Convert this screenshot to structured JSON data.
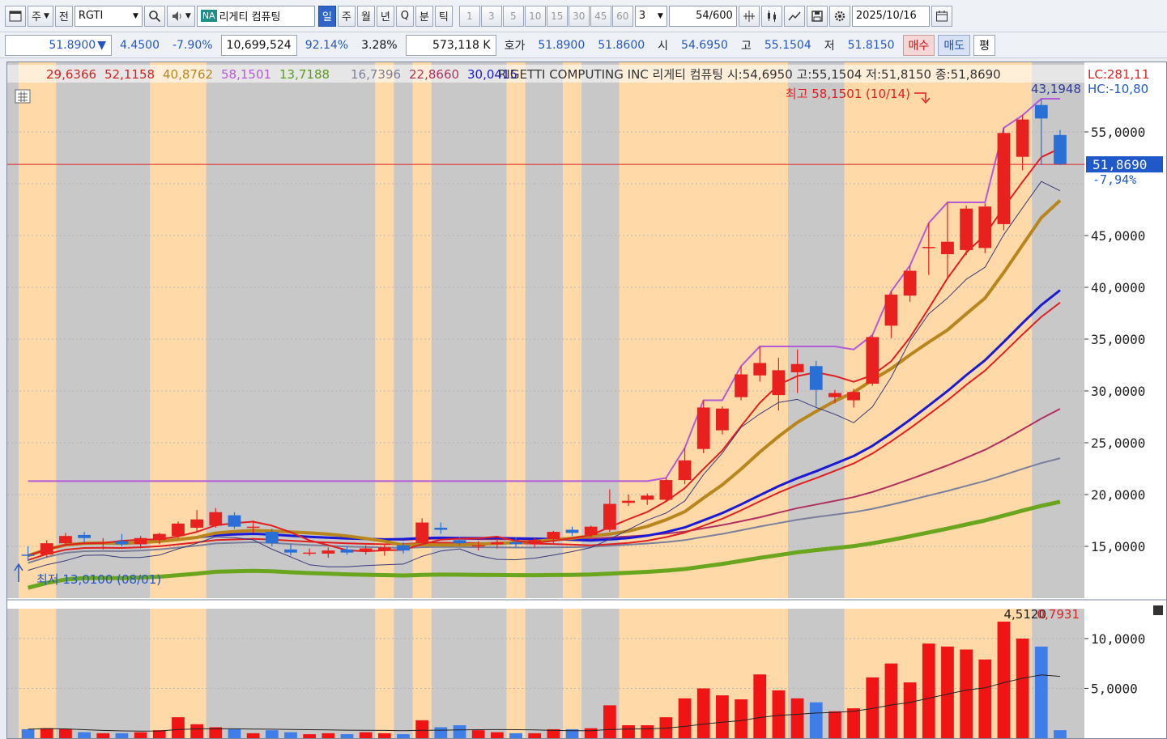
{
  "toolbar": {
    "market_label": "주",
    "mode_label": "전",
    "code": "RGTI",
    "code_badge": "NA",
    "stock_name": "리게티 컴퓨팅",
    "periods": [
      "일",
      "주",
      "월",
      "년",
      "Q",
      "분",
      "틱"
    ],
    "selected_period": "일",
    "minutes": [
      "1",
      "3",
      "5",
      "10",
      "15",
      "30",
      "45",
      "60"
    ],
    "custom_minute": "3",
    "count": "54/600",
    "date": "2025/10/16"
  },
  "quote": {
    "price": "51.8900",
    "direction": "▼",
    "change": "4.4500",
    "change_pct": "-7.90%",
    "volume": "10,699,524",
    "volume_ratio": "92.14%",
    "turnover": "3.28%",
    "amount": "573,118 K",
    "hoga_label": "호가",
    "ask": "51.8900",
    "bid": "51.8600",
    "open_label": "시",
    "open": "54.6950",
    "high_label": "고",
    "high": "55.1504",
    "low_label": "저",
    "low": "51.8150",
    "buy_button": "매수",
    "sell_button": "매도",
    "avg_button": "평"
  },
  "overlay": {
    "ma_values": [
      {
        "text": "29,6366",
        "color": "#d62020"
      },
      {
        "text": "52,1158",
        "color": "#d62020"
      },
      {
        "text": "40,8762",
        "color": "#b8861c"
      },
      {
        "text": "58,1501",
        "color": "#b35ad6"
      },
      {
        "text": "13,7188",
        "color": "#5a9c1c"
      },
      {
        "text": "16,7396",
        "color": "#7b7f9a"
      },
      {
        "text": "22,8660",
        "color": "#b03060"
      },
      {
        "text": "30,0415",
        "color": "#1a1ad6"
      }
    ],
    "stock_info": "RIGETTI COMPUTING INC  리게티 컴퓨팅 시:54,6950 고:55,1504 저:51,8150 종:51,8690",
    "lc": "LC:281,11",
    "hc": "HC:-10,80",
    "right_value": "43,1948",
    "high_annotation": "최고 58,1501 (10/14)",
    "low_annotation": "최저 13,0100 (08/01)",
    "current_price_tag": "51,8690",
    "current_change_tag": "-7,94%",
    "volume_values": [
      "4,5120",
      "0,7931"
    ]
  },
  "chart_data": {
    "type": "candlestick",
    "price_axis": {
      "ticks": [
        "15,0000",
        "20,0000",
        "25,0000",
        "30,0000",
        "35,0000",
        "40,0000",
        "45,0000",
        "55,0000"
      ],
      "ylim": [
        10,
        60
      ]
    },
    "volume_axis": {
      "ticks": [
        "5,0000",
        "10,0000"
      ],
      "ylim": [
        0,
        13
      ]
    },
    "current_price": 51.869,
    "candles": [
      {
        "o": 14.2,
        "h": 15.0,
        "l": 13.6,
        "c": 14.1,
        "v": 0.9
      },
      {
        "o": 14.2,
        "h": 15.6,
        "l": 13.9,
        "c": 15.3,
        "v": 1.0
      },
      {
        "o": 15.3,
        "h": 16.3,
        "l": 15.0,
        "c": 16.0,
        "v": 0.9
      },
      {
        "o": 16.1,
        "h": 16.4,
        "l": 15.4,
        "c": 15.8,
        "v": 0.6
      },
      {
        "o": 15.3,
        "h": 15.8,
        "l": 14.7,
        "c": 15.4,
        "v": 0.5
      },
      {
        "o": 15.5,
        "h": 16.2,
        "l": 15.0,
        "c": 15.2,
        "v": 0.5
      },
      {
        "o": 15.2,
        "h": 16.0,
        "l": 14.8,
        "c": 15.8,
        "v": 0.6
      },
      {
        "o": 15.6,
        "h": 16.3,
        "l": 15.2,
        "c": 16.2,
        "v": 0.8
      },
      {
        "o": 16.0,
        "h": 17.4,
        "l": 15.8,
        "c": 17.2,
        "v": 2.1
      },
      {
        "o": 16.8,
        "h": 18.5,
        "l": 16.4,
        "c": 17.6,
        "v": 1.4
      },
      {
        "o": 17.0,
        "h": 18.7,
        "l": 16.8,
        "c": 18.3,
        "v": 1.1
      },
      {
        "o": 18.0,
        "h": 18.3,
        "l": 16.7,
        "c": 16.9,
        "v": 0.9
      },
      {
        "o": 16.9,
        "h": 17.5,
        "l": 16.3,
        "c": 16.9,
        "v": 0.5
      },
      {
        "o": 16.4,
        "h": 16.7,
        "l": 15.0,
        "c": 15.3,
        "v": 0.8
      },
      {
        "o": 14.7,
        "h": 15.2,
        "l": 14.1,
        "c": 14.4,
        "v": 0.6
      },
      {
        "o": 14.4,
        "h": 14.8,
        "l": 14.1,
        "c": 14.4,
        "v": 0.4
      },
      {
        "o": 14.3,
        "h": 14.9,
        "l": 13.9,
        "c": 14.6,
        "v": 0.5
      },
      {
        "o": 14.7,
        "h": 15.0,
        "l": 14.2,
        "c": 14.4,
        "v": 0.4
      },
      {
        "o": 14.5,
        "h": 15.1,
        "l": 14.2,
        "c": 14.8,
        "v": 0.6
      },
      {
        "o": 14.6,
        "h": 15.2,
        "l": 14.1,
        "c": 14.9,
        "v": 0.5
      },
      {
        "o": 15.1,
        "h": 15.4,
        "l": 14.3,
        "c": 14.6,
        "v": 0.4
      },
      {
        "o": 15.4,
        "h": 17.7,
        "l": 15.2,
        "c": 17.3,
        "v": 1.8
      },
      {
        "o": 16.8,
        "h": 17.3,
        "l": 16.2,
        "c": 16.6,
        "v": 1.1
      },
      {
        "o": 15.6,
        "h": 15.9,
        "l": 15.1,
        "c": 15.3,
        "v": 1.3
      },
      {
        "o": 15.0,
        "h": 15.5,
        "l": 14.6,
        "c": 15.1,
        "v": 0.8
      },
      {
        "o": 15.2,
        "h": 15.7,
        "l": 14.8,
        "c": 15.4,
        "v": 0.6
      },
      {
        "o": 15.4,
        "h": 15.9,
        "l": 14.9,
        "c": 15.2,
        "v": 0.5
      },
      {
        "o": 15.4,
        "h": 15.8,
        "l": 14.9,
        "c": 15.6,
        "v": 0.5
      },
      {
        "o": 15.7,
        "h": 16.5,
        "l": 15.3,
        "c": 16.4,
        "v": 0.9
      },
      {
        "o": 16.6,
        "h": 16.9,
        "l": 16.0,
        "c": 16.3,
        "v": 0.9
      },
      {
        "o": 16.1,
        "h": 17.0,
        "l": 15.9,
        "c": 16.9,
        "v": 1.0
      },
      {
        "o": 16.6,
        "h": 20.5,
        "l": 16.4,
        "c": 19.1,
        "v": 3.3
      },
      {
        "o": 19.2,
        "h": 20.0,
        "l": 18.9,
        "c": 19.4,
        "v": 1.3
      },
      {
        "o": 19.5,
        "h": 20.1,
        "l": 19.0,
        "c": 19.9,
        "v": 1.3
      },
      {
        "o": 19.5,
        "h": 21.6,
        "l": 19.3,
        "c": 21.4,
        "v": 2.1
      },
      {
        "o": 21.4,
        "h": 24.5,
        "l": 21.0,
        "c": 23.3,
        "v": 4.0
      },
      {
        "o": 24.4,
        "h": 29.1,
        "l": 24.0,
        "c": 28.4,
        "v": 5.0
      },
      {
        "o": 26.2,
        "h": 28.5,
        "l": 25.8,
        "c": 28.3,
        "v": 4.3
      },
      {
        "o": 29.4,
        "h": 32.4,
        "l": 29.1,
        "c": 31.6,
        "v": 3.9
      },
      {
        "o": 31.5,
        "h": 34.3,
        "l": 30.9,
        "c": 32.7,
        "v": 6.4
      },
      {
        "o": 29.6,
        "h": 33.2,
        "l": 28.1,
        "c": 32.0,
        "v": 4.8
      },
      {
        "o": 31.8,
        "h": 34.0,
        "l": 29.8,
        "c": 32.6,
        "v": 4.0
      },
      {
        "o": 32.4,
        "h": 32.9,
        "l": 28.5,
        "c": 30.1,
        "v": 3.6
      },
      {
        "o": 29.4,
        "h": 30.1,
        "l": 28.8,
        "c": 29.8,
        "v": 2.7
      },
      {
        "o": 29.1,
        "h": 30.2,
        "l": 28.4,
        "c": 29.9,
        "v": 3.0
      },
      {
        "o": 30.7,
        "h": 35.4,
        "l": 30.5,
        "c": 35.2,
        "v": 6.1
      },
      {
        "o": 36.3,
        "h": 39.6,
        "l": 35.1,
        "c": 39.3,
        "v": 7.5
      },
      {
        "o": 39.2,
        "h": 42.1,
        "l": 38.6,
        "c": 41.6,
        "v": 5.6
      },
      {
        "o": 43.9,
        "h": 46.2,
        "l": 41.2,
        "c": 43.9,
        "v": 9.5
      },
      {
        "o": 43.2,
        "h": 48.2,
        "l": 40.8,
        "c": 44.4,
        "v": 9.2
      },
      {
        "o": 43.6,
        "h": 47.9,
        "l": 43.1,
        "c": 47.6,
        "v": 8.9
      },
      {
        "o": 43.8,
        "h": 48.1,
        "l": 43.3,
        "c": 47.8,
        "v": 7.9
      },
      {
        "o": 46.1,
        "h": 55.4,
        "l": 45.5,
        "c": 54.9,
        "v": 11.7
      },
      {
        "o": 52.6,
        "h": 56.6,
        "l": 51.3,
        "c": 56.2,
        "v": 10.0
      },
      {
        "o": 57.6,
        "h": 58.2,
        "l": 51.8,
        "c": 56.3,
        "v": 9.2
      },
      {
        "o": 54.7,
        "h": 55.2,
        "l": 51.8,
        "c": 51.9,
        "v": 0.8
      }
    ]
  }
}
